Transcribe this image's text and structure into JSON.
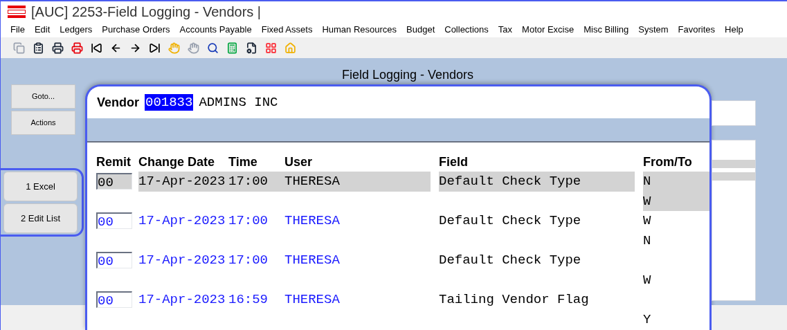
{
  "window": {
    "title": "[AUC] 2253-Field Logging - Vendors |"
  },
  "menu": [
    "File",
    "Edit",
    "Ledgers",
    "Purchase Orders",
    "Accounts Payable",
    "Fixed Assets",
    "Human Resources",
    "Budget",
    "Collections",
    "Tax",
    "Motor Excise",
    "Misc Billing",
    "System",
    "Favorites",
    "Help"
  ],
  "screen_title": "Field Logging - Vendors",
  "side_buttons": [
    {
      "label": "Goto..."
    },
    {
      "label": "Actions"
    }
  ],
  "action_buttons": [
    {
      "label": "1 Excel"
    },
    {
      "label": "2 Edit List"
    }
  ],
  "vendor": {
    "label": "Vendor",
    "number": "001833",
    "name": "ADMINS INC"
  },
  "table": {
    "columns": [
      "Remit",
      "Change Date",
      "Time",
      "User",
      "Field",
      "From/To"
    ],
    "rows": [
      {
        "remit": "00",
        "date": "17-Apr-2023",
        "time": "17:00",
        "user": "THERESA",
        "field": "Default Check Type",
        "from": "N",
        "to": "W",
        "selected": true
      },
      {
        "remit": "00",
        "date": "17-Apr-2023",
        "time": "17:00",
        "user": "THERESA",
        "field": "Default Check Type",
        "from": "W",
        "to": "N",
        "selected": false
      },
      {
        "remit": "00",
        "date": "17-Apr-2023",
        "time": "17:00",
        "user": "THERESA",
        "field": "Default Check Type",
        "to": "W",
        "selected": false
      },
      {
        "remit": "00",
        "date": "17-Apr-2023",
        "time": "16:59",
        "user": "THERESA",
        "field": "Tailing Vendor Flag",
        "to": "Y",
        "selected": false
      }
    ]
  }
}
